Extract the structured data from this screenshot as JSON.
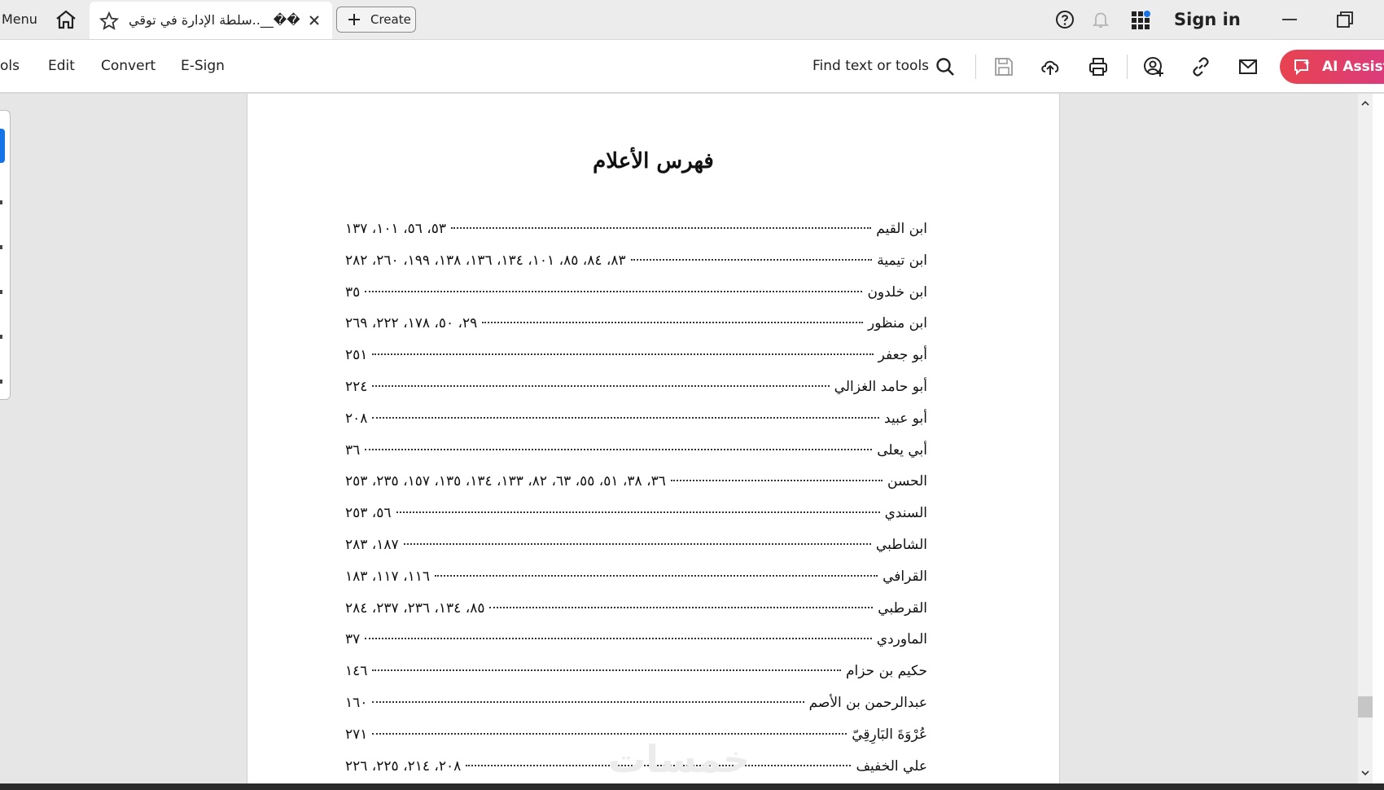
{
  "titlebar": {
    "menu_label": "Menu",
    "tab_title": "سلطة الإدارة في توقي..__��",
    "create_label": "Create",
    "sign_in_label": "Sign in"
  },
  "toolbar": {
    "items": [
      "ols",
      "Edit",
      "Convert",
      "E-Sign"
    ],
    "find_label": "Find text or tools",
    "ai_label": "AI Assista"
  },
  "document": {
    "title": "فهرس الأعلام",
    "entries": [
      {
        "name": "ابن القيم",
        "pages": "٥٣، ٥٦، ١٠١، ١٣٧"
      },
      {
        "name": "ابن تيمية",
        "pages": "٨٣، ٨٤، ٨٥، ١٠١، ١٣٤، ١٣٦، ١٣٨، ١٩٩، ٢٦٠، ٢٨٢"
      },
      {
        "name": "ابن خلدون",
        "pages": "٣٥"
      },
      {
        "name": "ابن منظور",
        "pages": "٢٩، ٥٠، ١٧٨، ٢٢٢، ٢٦٩"
      },
      {
        "name": "أبو جعفر",
        "pages": "٢٥١"
      },
      {
        "name": "أبو حامد الغزالي",
        "pages": "٢٢٤"
      },
      {
        "name": "أبو عبيد",
        "pages": "٢٠٨"
      },
      {
        "name": "أبي يعلى",
        "pages": "٣٦"
      },
      {
        "name": "الحسن",
        "pages": "٣٦، ٣٨، ٥١، ٥٥، ٦٣، ٨٢، ١٣٣، ١٣٤، ١٣٥، ١٥٧، ٢٣٥، ٢٥٣"
      },
      {
        "name": "السندي",
        "pages": "٥٦، ٢٥٣"
      },
      {
        "name": "الشاطبي",
        "pages": "١٨٧، ٢٨٣"
      },
      {
        "name": "القرافي",
        "pages": "١١٦، ١١٧، ١٨٣"
      },
      {
        "name": "القرطبي",
        "pages": "٨٥، ١٣٤، ٢٣٦، ٢٣٧، ٢٨٤"
      },
      {
        "name": "الماوردي",
        "pages": "٣٧"
      },
      {
        "name": "حكيم بن حزام",
        "pages": "١٤٦"
      },
      {
        "name": "عبدالرحمن بن الأصم",
        "pages": "١٦٠"
      },
      {
        "name": "عُرْوَةَ البَارِقِيّ",
        "pages": "٢٧١"
      },
      {
        "name": "علي الخفيف",
        "pages": "٢٠٨، ٢١٤، ٢٢٥، ٢٢٦"
      }
    ],
    "watermark": "خمسات"
  }
}
